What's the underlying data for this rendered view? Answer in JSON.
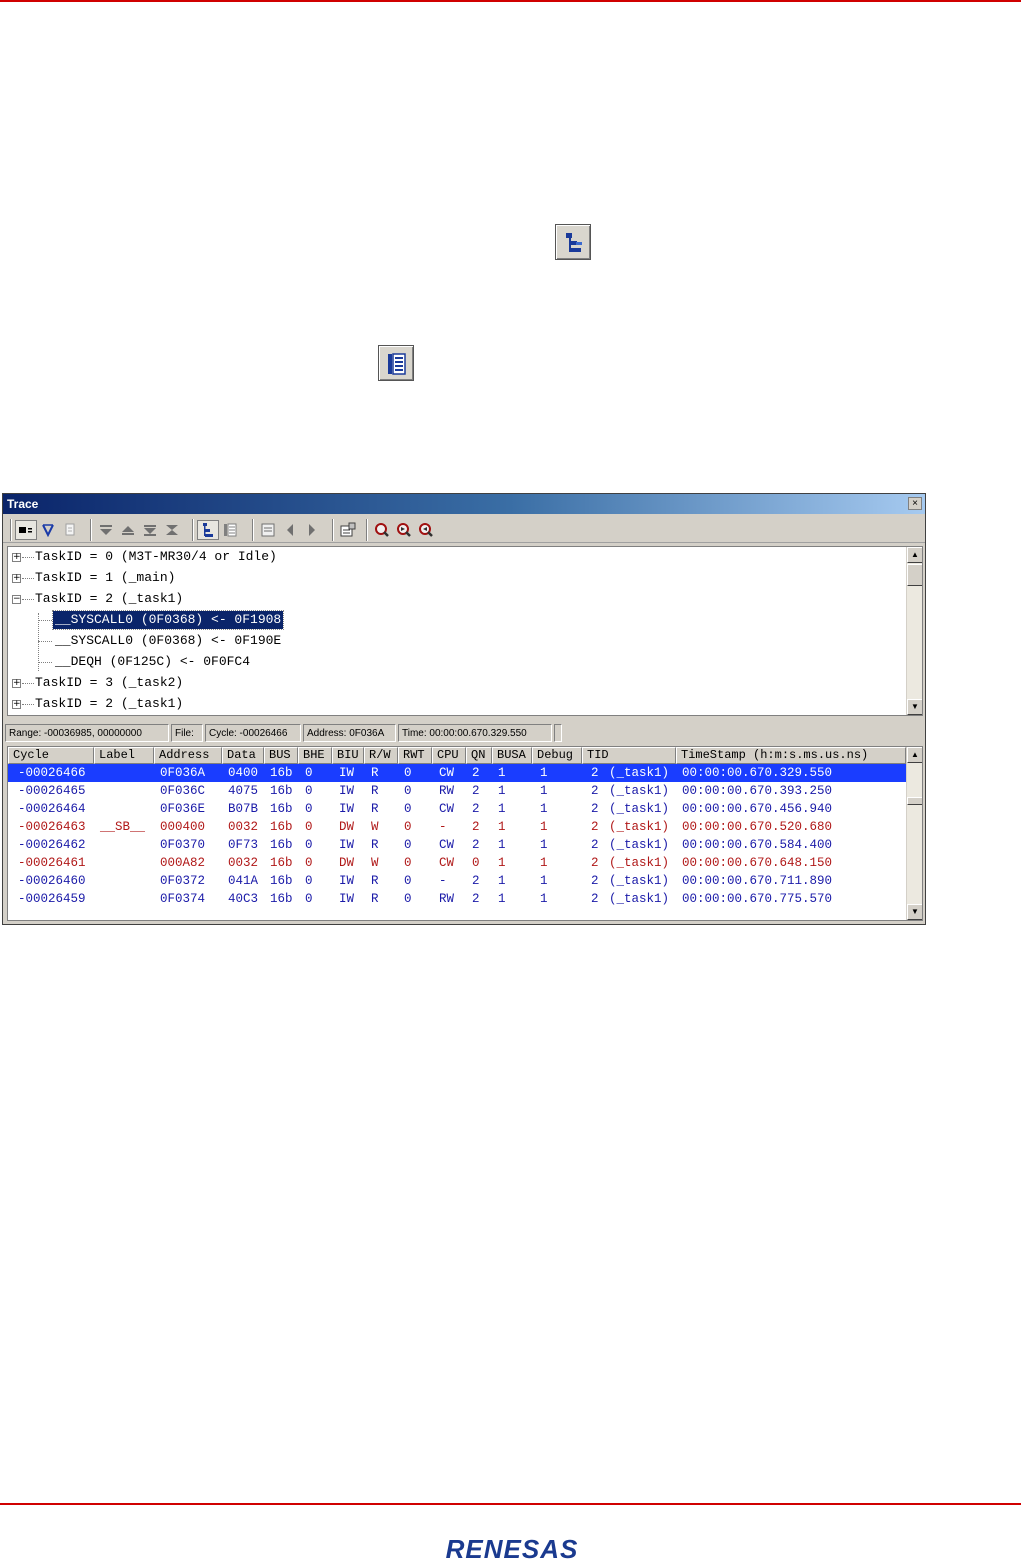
{
  "trace": {
    "title": "Trace",
    "close_glyph": "×",
    "toolbar_icons": [
      "record-icon",
      "filter-icon",
      "page-icon",
      "first-icon",
      "previous-block-icon",
      "next-block-icon",
      "last-icon",
      "function-tree-icon",
      "function-list-icon",
      "list-view-icon",
      "back-icon",
      "forward-icon",
      "settings-icon",
      "search-icon",
      "search-next-icon",
      "search-previous-icon"
    ],
    "tree": [
      {
        "text": "TaskID = 0 (M3T-MR30/4 or Idle)",
        "expander": "+"
      },
      {
        "text": "TaskID = 1 (_main)",
        "expander": "+"
      },
      {
        "text": "TaskID = 2 (_task1)",
        "expander": "−"
      },
      {
        "text": "__SYSCALL0 (0F0368) <- 0F1908",
        "selected": true
      },
      {
        "text": "__SYSCALL0 (0F0368) <- 0F190E"
      },
      {
        "text": "__DEQH (0F125C) <- 0F0FC4"
      },
      {
        "text": "TaskID = 3 (_task2)",
        "expander": "+"
      },
      {
        "text": "TaskID = 2 (_task1)",
        "expander": "+"
      }
    ],
    "status": {
      "range": "Range: -00036985,  00000000",
      "file": "File:",
      "cycle": "Cycle: -00026466",
      "address": "Address: 0F036A",
      "time": "Time: 00:00:00.670.329.550"
    },
    "columns": [
      "Cycle",
      "Label",
      "Address",
      "Data",
      "BUS",
      "BHE",
      "BIU",
      "R/W",
      "RWT",
      "CPU",
      "QN",
      "BUSA",
      "Debug",
      "TID",
      "TimeStamp (h:m:s.ms.us.ns)"
    ],
    "rows": [
      {
        "color": "selected",
        "cells": [
          "-00026466",
          "",
          "0F036A",
          "0400",
          "16b",
          "0",
          "IW",
          "R",
          "0",
          "CW",
          "2",
          "1",
          "1",
          "2",
          "(_task1)",
          "00:00:00.670.329.550"
        ]
      },
      {
        "color": "blue",
        "cells": [
          "-00026465",
          "",
          "0F036C",
          "4075",
          "16b",
          "0",
          "IW",
          "R",
          "0",
          "RW",
          "2",
          "1",
          "1",
          "2",
          "(_task1)",
          "00:00:00.670.393.250"
        ]
      },
      {
        "color": "blue",
        "cells": [
          "-00026464",
          "",
          "0F036E",
          "B07B",
          "16b",
          "0",
          "IW",
          "R",
          "0",
          "CW",
          "2",
          "1",
          "1",
          "2",
          "(_task1)",
          "00:00:00.670.456.940"
        ]
      },
      {
        "color": "red",
        "cells": [
          "-00026463",
          "__SB__",
          "000400",
          "0032",
          "16b",
          "0",
          "DW",
          "W",
          "0",
          "-",
          "2",
          "1",
          "1",
          "2",
          "(_task1)",
          "00:00:00.670.520.680"
        ]
      },
      {
        "color": "blue",
        "cells": [
          "-00026462",
          "",
          "0F0370",
          "0F73",
          "16b",
          "0",
          "IW",
          "R",
          "0",
          "CW",
          "2",
          "1",
          "1",
          "2",
          "(_task1)",
          "00:00:00.670.584.400"
        ]
      },
      {
        "color": "red",
        "cells": [
          "-00026461",
          "",
          "000A82",
          "0032",
          "16b",
          "0",
          "DW",
          "W",
          "0",
          "CW",
          "0",
          "1",
          "1",
          "2",
          "(_task1)",
          "00:00:00.670.648.150"
        ]
      },
      {
        "color": "blue",
        "cells": [
          "-00026460",
          "",
          "0F0372",
          "041A",
          "16b",
          "0",
          "IW",
          "R",
          "0",
          "-",
          "2",
          "1",
          "1",
          "2",
          "(_task1)",
          "00:00:00.670.711.890"
        ]
      },
      {
        "color": "blue",
        "cells": [
          "-00026459",
          "",
          "0F0374",
          "40C3",
          "16b",
          "0",
          "IW",
          "R",
          "0",
          "RW",
          "2",
          "1",
          "1",
          "2",
          "(_task1)",
          "00:00:00.670.775.570"
        ]
      }
    ]
  },
  "inline_icons": [
    "function-tree-icon",
    "function-list-icon"
  ],
  "footer": {
    "logo_text": "RENESAS",
    "brand_color": "#1a3a8f",
    "rule_color": "#d00000"
  }
}
